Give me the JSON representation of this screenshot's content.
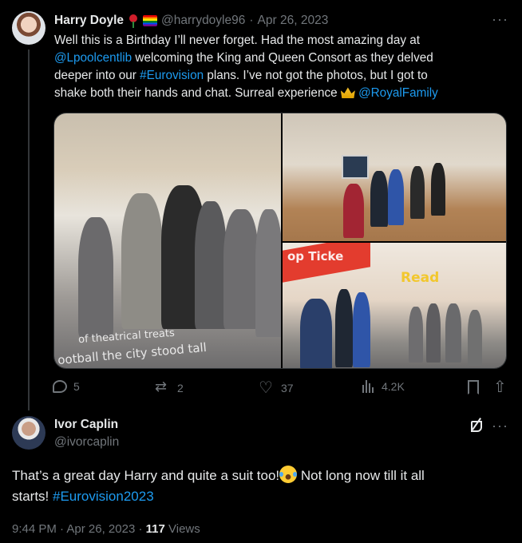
{
  "tweet1": {
    "author_name": "Harry Doyle",
    "handle": "@harrydoyle96",
    "separator": "·",
    "date": "Apr 26, 2023",
    "more_label": "···",
    "text_lines": [
      [
        {
          "t": "Well this is a Birthday I’ll never forget. Had the most amazing day at",
          "link": false
        }
      ],
      [
        {
          "t": "@Lpoolcentlib",
          "link": true
        },
        {
          "t": " welcoming the King and Queen Consort as they delved",
          "link": false
        }
      ],
      [
        {
          "t": "deeper into our ",
          "link": false
        },
        {
          "t": "#Eurovision",
          "link": true
        },
        {
          "t": " plans. I’ve not got the photos, but I got to",
          "link": false
        }
      ],
      [
        {
          "t": "shake both their hands and chat. Surreal experience ",
          "link": false
        },
        {
          "t": "CROWN",
          "emoji": "crown-icon"
        },
        {
          "t": " ",
          "link": false
        },
        {
          "t": "@RoyalFamily",
          "link": true
        }
      ]
    ],
    "photo_floor_text": [
      "of theatrical treats",
      "ootball the city stood tall"
    ],
    "photo_sign_text": [
      "op Ticke",
      "Read"
    ],
    "actions": {
      "replies": "5",
      "reposts": "2",
      "likes": "37",
      "views": "4.2K"
    }
  },
  "tweet2": {
    "author_name": "Ivor Caplin",
    "handle": "@ivorcaplin",
    "more_label": "···",
    "text_lines": [
      [
        {
          "t": "That’s a great day Harry and quite a suit too!",
          "link": false
        },
        {
          "t": "JOY",
          "emoji": "joy-emoji"
        },
        {
          "t": " Not long now till it all",
          "link": false
        }
      ],
      [
        {
          "t": "starts! ",
          "link": false
        },
        {
          "t": "#Eurovision2023",
          "link": true
        }
      ]
    ],
    "time": "9:44 PM",
    "separator": "·",
    "date": "Apr 26, 2023",
    "views_count": "117",
    "views_label": "Views"
  },
  "colors": {
    "background": "#000000",
    "text": "#e7e9ea",
    "muted": "#71767b",
    "link": "#1d9bf0"
  }
}
